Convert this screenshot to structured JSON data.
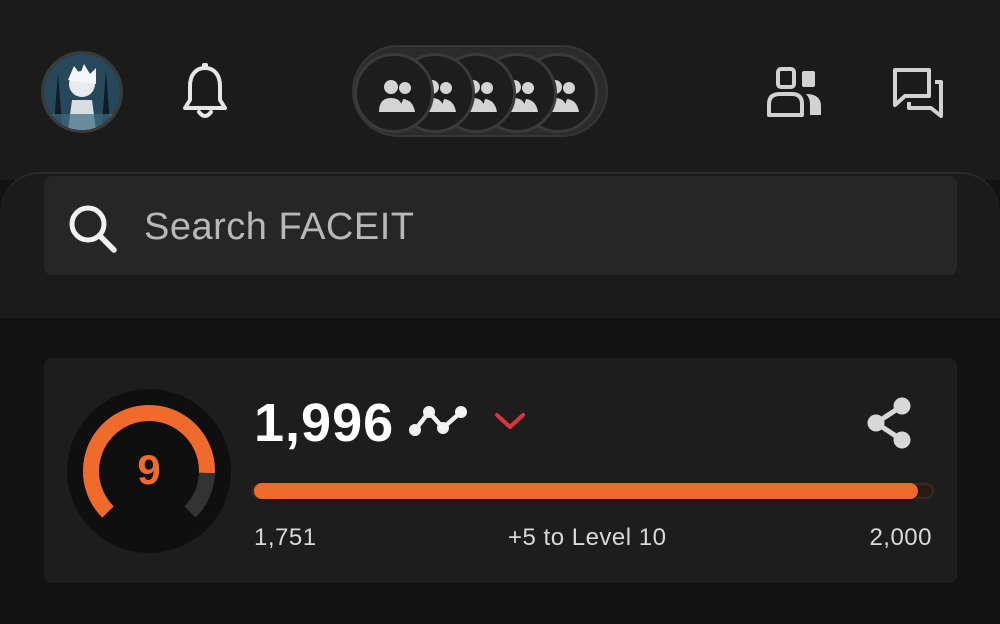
{
  "header": {
    "avatar": "user-avatar",
    "notifications_icon": "bell-icon",
    "party_slots": [
      "party-member-icon",
      "party-member-icon",
      "party-member-icon",
      "party-member-icon",
      "party-member-icon"
    ],
    "friends_icon": "friends-icon",
    "chat_icon": "chat-icon"
  },
  "search": {
    "placeholder": "Search FACEIT",
    "icon": "search-icon"
  },
  "elo_card": {
    "level": "9",
    "elo": "1,996",
    "progress_min": "1,751",
    "progress_status": "+5 to Level 10",
    "progress_max": "2,000",
    "progress_fraction": 0.98,
    "gauge_fraction": 0.84,
    "accent_color": "#f06a2c",
    "dropdown_color": "#e0313c"
  }
}
